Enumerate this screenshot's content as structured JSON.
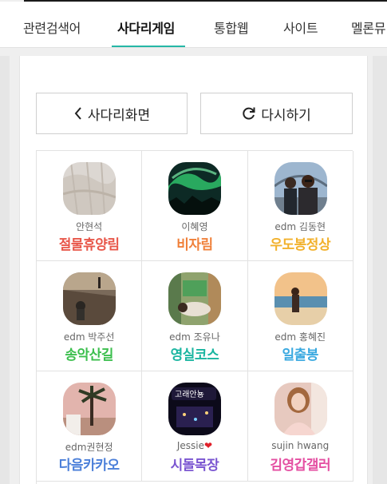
{
  "tabs": [
    {
      "label": "관련검색어",
      "active": false
    },
    {
      "label": "사다리게임",
      "active": true
    },
    {
      "label": "통합웹",
      "active": false
    },
    {
      "label": "사이트",
      "active": false
    },
    {
      "label": "멜론뮤",
      "active": false
    }
  ],
  "accent_color": "#25b7a6",
  "buttons": {
    "back_label": "사다리화면",
    "back_icon": "chevron-left-icon",
    "retry_label": "다시하기",
    "retry_icon": "refresh-icon"
  },
  "results": [
    {
      "name": "안현석",
      "place": "절물휴양림",
      "place_color": "#e8574a",
      "photo": "fabric-photo"
    },
    {
      "name": "이혜영",
      "place": "비자림",
      "place_color": "#f0803a",
      "photo": "aurora-photo"
    },
    {
      "name": "edm 김동현",
      "place": "우도봉정상",
      "place_color": "#f2b12c",
      "photo": "couple-bridge-photo"
    },
    {
      "name": "edm 박주선",
      "place": "송악산길",
      "place_color": "#3cbf4e",
      "photo": "beach-child-photo"
    },
    {
      "name": "edm 조유나",
      "place": "영실코스",
      "place_color": "#19b5a0",
      "photo": "reading-person-photo"
    },
    {
      "name": "edm 홍혜진",
      "place": "일출봉",
      "place_color": "#3aa9e0",
      "photo": "sunset-beach-photo"
    },
    {
      "name": "edm권현정",
      "place": "다음카카오",
      "place_color": "#4b7fd9",
      "photo": "palm-tree-photo"
    },
    {
      "name": "Jessie",
      "name_suffix": "❤",
      "place": "시돌목장",
      "place_color": "#7a55d1",
      "photo": "night-sign-photo",
      "photo_text": "고래안뇽"
    },
    {
      "name": "sujin hwang",
      "place": "김영갑갤러",
      "place_color": "#e44fa2",
      "photo": "woman-portrait-photo"
    }
  ]
}
